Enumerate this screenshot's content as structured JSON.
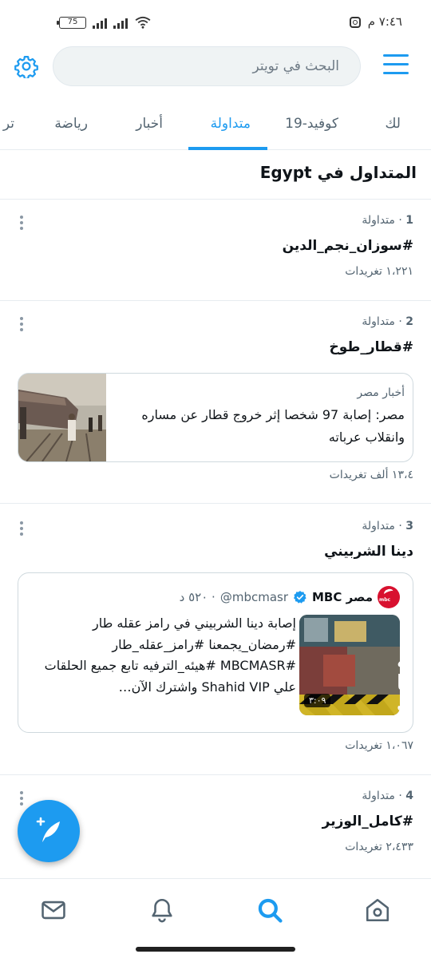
{
  "status_bar": {
    "time": "٧:٤٦ م",
    "battery": "75"
  },
  "search": {
    "placeholder": "البحث في تويتر"
  },
  "tabs": [
    {
      "label": "لك"
    },
    {
      "label": "كوفيد-19"
    },
    {
      "label": "متداولة"
    },
    {
      "label": "أخبار"
    },
    {
      "label": "رياضة"
    },
    {
      "label": "تر"
    }
  ],
  "heading": "المتداول في Egypt",
  "trends": [
    {
      "rank": "1",
      "meta": "· متداولة",
      "title": "#سوزان_نجم_الدين",
      "count": "١،٢٢١ تغريدات"
    },
    {
      "rank": "2",
      "meta": "· متداولة",
      "title": "#قطار_طوخ",
      "news": {
        "source": "أخبار مصر",
        "headline": "مصر: إصابة 97 شخصا إثر خروج قطار عن مساره وانقلاب عرباته"
      },
      "count": "١٣،٤ ألف تغريدات"
    },
    {
      "rank": "3",
      "meta": "· متداولة",
      "title": "دينا الشربيني",
      "tweet": {
        "name": "مصر MBC",
        "handle": "@mbcmasr",
        "time": "· ٥٢٠ د",
        "text": "إصابة دينا الشربيني في رامز عقله طار #رمضان_يجمعنا #رامز_عقله_طار #MBCMASR #هيئه_الترفيه تابع جميع الحلقات علي Shahid VIP واشترك الآن…",
        "video_duration": "٣:٠٩"
      },
      "count": "١،٠٦٧ تغريدات"
    },
    {
      "rank": "4",
      "meta": "· متداولة",
      "title": "#كامل_الوزير",
      "count": "٢،٤٣٣ تغريدات"
    }
  ],
  "colors": {
    "accent": "#1d9bf0",
    "text": "#0f1419",
    "secondary": "#536471"
  },
  "icons": {
    "menu": "menu-icon",
    "settings": "gear-icon",
    "compose": "compose-icon",
    "messages": "mail-icon",
    "notifications": "bell-icon",
    "explore": "search-icon",
    "home": "home-icon"
  }
}
